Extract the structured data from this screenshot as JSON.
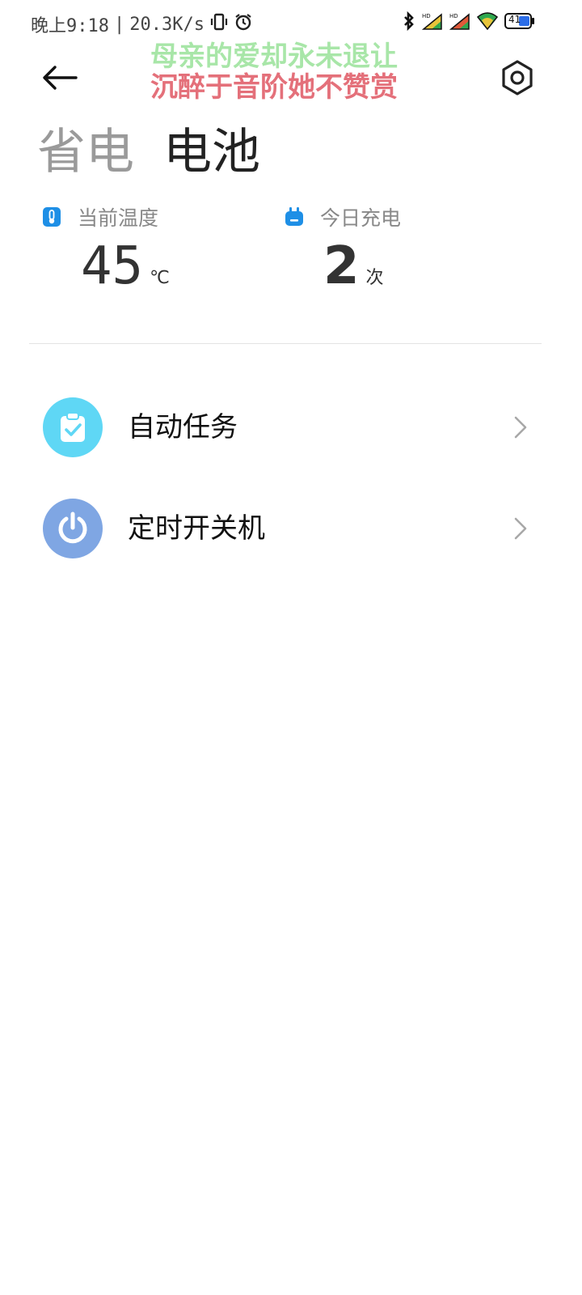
{
  "status_bar": {
    "time": "晚上9:18",
    "separator": "|",
    "net_speed": "20.3K/s",
    "battery_level": "41",
    "icons": [
      "vibrate-icon",
      "alarm-icon",
      "bluetooth-icon",
      "signal-hd-icon",
      "signal-hd-icon",
      "wifi-icon",
      "battery-icon"
    ]
  },
  "lyrics": {
    "line1": "母亲的爱却永未退让",
    "line2": "沉醉于音阶她不赞赏"
  },
  "nav": {
    "back_icon": "back-arrow-icon",
    "settings_icon": "gear-icon"
  },
  "tabs": [
    {
      "label": "省电",
      "active": false
    },
    {
      "label": "电池",
      "active": true
    }
  ],
  "stats": {
    "temperature": {
      "label": "当前温度",
      "value": "45",
      "unit": "℃",
      "icon": "thermometer-icon"
    },
    "charge": {
      "label": "今日充电",
      "value": "2",
      "unit": "次",
      "icon": "plug-icon"
    }
  },
  "list": [
    {
      "label": "自动任务",
      "icon": "clipboard-check-icon"
    },
    {
      "label": "定时开关机",
      "icon": "power-icon"
    }
  ],
  "colors": {
    "accent_blue": "#1e8fe6",
    "auto_task_bg": "#5fd7f5",
    "power_bg": "#7fa6e3",
    "lyric_green": "#a8e6a8",
    "lyric_red": "#e4707a"
  }
}
